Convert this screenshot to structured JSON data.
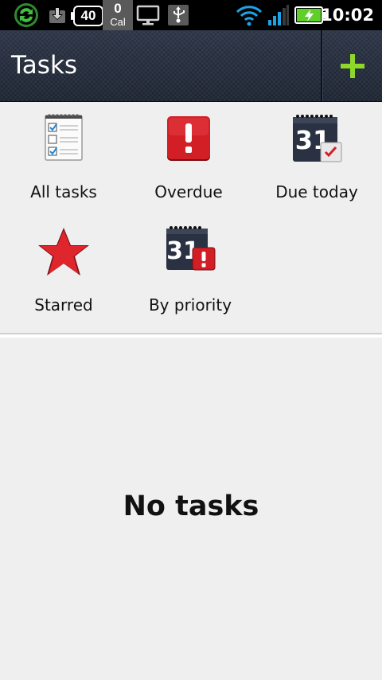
{
  "status_bar": {
    "time": "10:02",
    "badge_count": "40",
    "calendar_count": "0",
    "calendar_label": "Cal",
    "icons": [
      "sync-icon",
      "download-icon",
      "battery-badge-icon",
      "calendar-badge-icon",
      "monitor-icon",
      "usb-icon",
      "wifi-icon",
      "signal-icon",
      "battery-charging-icon"
    ]
  },
  "action_bar": {
    "title": "Tasks",
    "add_icon": "plus-icon",
    "accent": "#8fd82a"
  },
  "filters": [
    {
      "label": "All tasks",
      "icon": "checklist-icon"
    },
    {
      "label": "Overdue",
      "icon": "exclamation-icon"
    },
    {
      "label": "Due today",
      "icon": "calendar-check-icon",
      "day": "31"
    },
    {
      "label": "Starred",
      "icon": "star-icon"
    },
    {
      "label": "By priority",
      "icon": "calendar-priority-icon",
      "day": "31"
    }
  ],
  "empty_state": {
    "text": "No tasks"
  }
}
